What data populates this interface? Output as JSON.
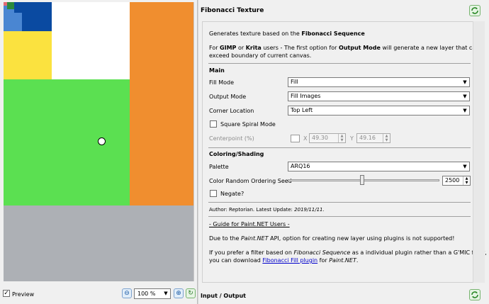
{
  "preview": {
    "checkbox_checked": true,
    "label": "Preview",
    "zoom_value": "100 %",
    "blocks": [
      {
        "name": "red-block",
        "color": "#e36b73"
      },
      {
        "name": "green-block",
        "color": "#2c8a3c"
      },
      {
        "name": "blue-light-block",
        "color": "#4a86d2"
      },
      {
        "name": "blue-dark-block",
        "color": "#0a4aa1"
      },
      {
        "name": "yellow-block",
        "color": "#fbe23f"
      },
      {
        "name": "white-block",
        "color": "#ffffff"
      },
      {
        "name": "lime-block",
        "color": "#5be051"
      },
      {
        "name": "orange-block",
        "color": "#f08e2f"
      },
      {
        "name": "gray-block",
        "color": "#adb0b5"
      }
    ]
  },
  "panel": {
    "title": "Fibonacci Texture",
    "io_label": "Input / Output"
  },
  "settings": {
    "desc_prefix": "Generates texture based on the ",
    "desc_bold": "Fibonacci Sequence",
    "users_for": "For ",
    "users_gimp": "GIMP",
    "users_or": " or ",
    "users_krita": "Krita",
    "users_mid": " users - The first option for ",
    "users_outputmode": "Output Mode",
    "users_end": " will generate a new layer that can",
    "users_line2": "exceed boundary of current canvas.",
    "section_main": "Main",
    "fill_mode_label": "Fill Mode",
    "fill_mode_value": "Fill",
    "output_mode_label": "Output Mode",
    "output_mode_value": "Fill Images",
    "corner_label": "Corner Location",
    "corner_value": "Top Left",
    "square_spiral_label": "Square Spiral Mode",
    "centerpoint_label": "Centerpoint (%)",
    "x_label": "X",
    "x_value": "49.30",
    "y_label": "Y",
    "y_value": "49.16",
    "section_coloring": "Coloring/Shading",
    "palette_label": "Palette",
    "palette_value": "ARQ16",
    "random_label": "Color Random Ordering Seed",
    "random_value": "2500",
    "negate_label": "Negate?",
    "author_line": "Author: Reptorian. Latest Update: ",
    "author_date": "2019/11/11.",
    "guide_link": "- Guide for Paint.NET Users -",
    "pdn_due": "Due to the ",
    "pdn_api": "Paint.NET",
    "pdn_rest": " API, option for creating new layer using plugins is not supported!",
    "pref_1": "If you prefer a filter based on ",
    "pref_fib": "Fibonacci Sequence",
    "pref_2": " as a individual plugin rather than a G'MIC filter,",
    "pref_3": "you can download ",
    "pref_link": "Fibonacci Fill plugin",
    "pref_4": " for ",
    "pref_pdn": "Paint.NET",
    "pref_5": "."
  },
  "icons": {
    "refresh": "refresh-icon",
    "zoom_out": "zoom-out-icon",
    "zoom_in": "zoom-in-icon",
    "zoom_reset": "zoom-fit-icon"
  }
}
